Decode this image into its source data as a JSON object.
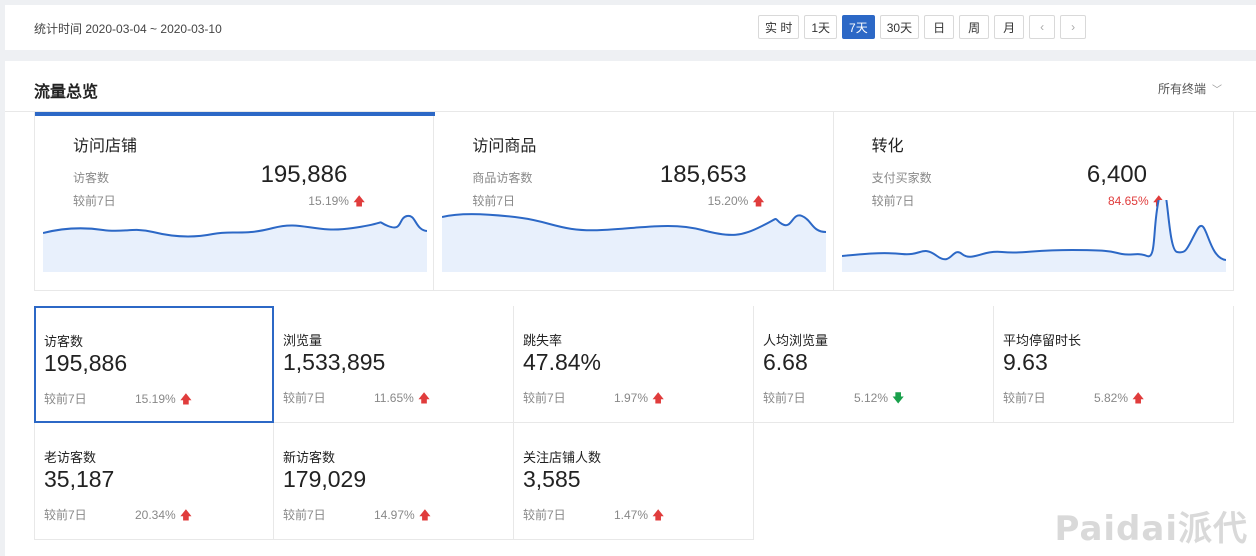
{
  "toolbar": {
    "date_range": "统计时间 2020-03-04 ~ 2020-03-10",
    "buttons": [
      "实 时",
      "1天",
      "7天",
      "30天",
      "日",
      "周",
      "月"
    ],
    "active_button": "7天",
    "prev_icon": "chevron-left-icon",
    "next_icon": "chevron-right-icon"
  },
  "panel": {
    "title": "流量总览",
    "terminal_select": "所有终端"
  },
  "overview": [
    {
      "title": "访问店铺",
      "sub_label": "访客数",
      "value": "195,886",
      "compare_label": "较前7日",
      "percent": "15.19%",
      "trend": "up"
    },
    {
      "title": "访问商品",
      "sub_label": "商品访客数",
      "value": "185,653",
      "compare_label": "较前7日",
      "percent": "15.20%",
      "trend": "up"
    },
    {
      "title": "转化",
      "sub_label": "支付买家数",
      "value": "6,400",
      "compare_label": "较前7日",
      "percent": "84.65%",
      "trend": "up"
    }
  ],
  "metrics": [
    {
      "label": "访客数",
      "value": "195,886",
      "compare_label": "较前7日",
      "percent": "15.19%",
      "trend": "up"
    },
    {
      "label": "浏览量",
      "value": "1,533,895",
      "compare_label": "较前7日",
      "percent": "11.65%",
      "trend": "up"
    },
    {
      "label": "跳失率",
      "value": "47.84%",
      "compare_label": "较前7日",
      "percent": "1.97%",
      "trend": "up"
    },
    {
      "label": "人均浏览量",
      "value": "6.68",
      "compare_label": "较前7日",
      "percent": "5.12%",
      "trend": "down"
    },
    {
      "label": "平均停留时长",
      "value": "9.63",
      "compare_label": "较前7日",
      "percent": "5.82%",
      "trend": "up"
    },
    {
      "label": "老访客数",
      "value": "35,187",
      "compare_label": "较前7日",
      "percent": "20.34%",
      "trend": "up"
    },
    {
      "label": "新访客数",
      "value": "179,029",
      "compare_label": "较前7日",
      "percent": "14.97%",
      "trend": "up"
    },
    {
      "label": "关注店铺人数",
      "value": "3,585",
      "compare_label": "较前7日",
      "percent": "1.47%",
      "trend": "up"
    }
  ],
  "colors": {
    "accent": "#2c68c6",
    "up": "#e03c3c",
    "down": "#19a04b",
    "spark_fill": "#e8f0fc"
  },
  "watermark": "Paidai派代"
}
